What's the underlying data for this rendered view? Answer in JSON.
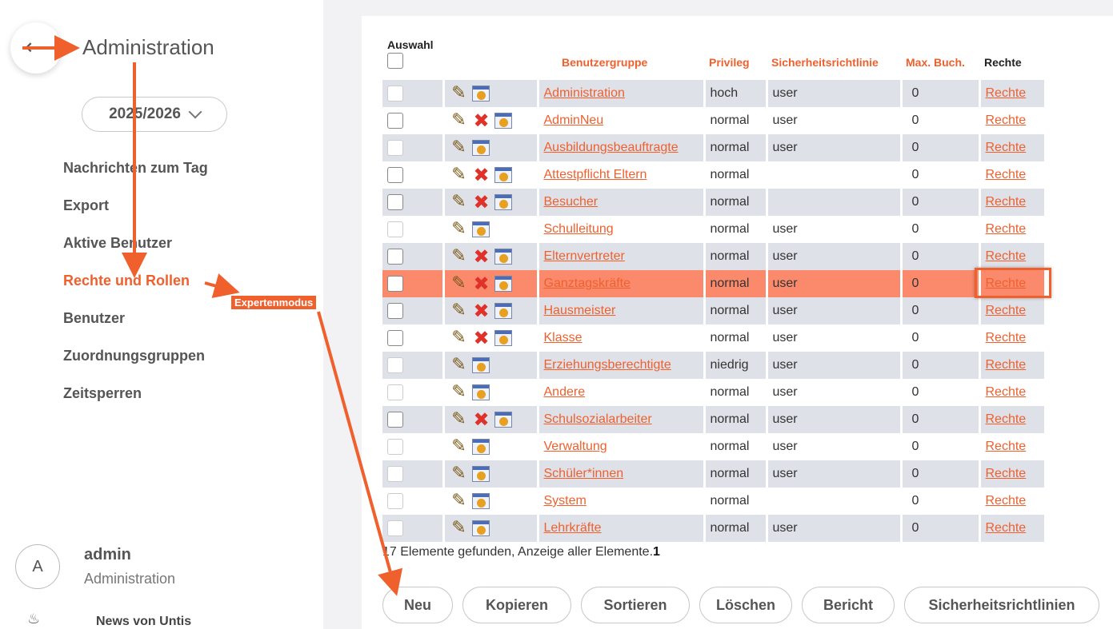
{
  "sidebar": {
    "title": "Administration",
    "year": "2025/2026",
    "nav": [
      "Nachrichten zum Tag",
      "Export",
      "Aktive Benutzer",
      "Rechte und Rollen",
      "Benutzer",
      "Zuordnungsgruppen",
      "Zeitsperren"
    ],
    "active_index": 3,
    "user": {
      "initial": "A",
      "name": "admin",
      "role": "Administration"
    },
    "news": "News von Untis"
  },
  "table": {
    "headers": {
      "select": "Auswahl",
      "group": "Benutzergruppe",
      "privilege": "Privileg",
      "policy": "Sicherheitsrichtlinie",
      "max": "Max. Buch.",
      "rights": "Rechte"
    },
    "rows": [
      {
        "name": "Administration",
        "privilege": "hoch",
        "policy": "user",
        "max": "0",
        "rights": "Rechte",
        "delete": false
      },
      {
        "name": "AdminNeu",
        "privilege": "normal",
        "policy": "user",
        "max": "0",
        "rights": "Rechte",
        "delete": true
      },
      {
        "name": "Ausbildungsbeauftragte",
        "privilege": "normal",
        "policy": "user",
        "max": "0",
        "rights": "Rechte",
        "delete": false
      },
      {
        "name": "Attestpflicht Eltern",
        "privilege": "normal",
        "policy": "",
        "max": "0",
        "rights": "Rechte",
        "delete": true
      },
      {
        "name": "Besucher",
        "privilege": "normal",
        "policy": "",
        "max": "0",
        "rights": "Rechte",
        "delete": true
      },
      {
        "name": "Schulleitung",
        "privilege": "normal",
        "policy": "user",
        "max": "0",
        "rights": "Rechte",
        "delete": false
      },
      {
        "name": "Elternvertreter",
        "privilege": "normal",
        "policy": "user",
        "max": "0",
        "rights": "Rechte",
        "delete": true
      },
      {
        "name": "Ganztagskräfte",
        "privilege": "normal",
        "policy": "user",
        "max": "0",
        "rights": "Rechte",
        "delete": true
      },
      {
        "name": "Hausmeister",
        "privilege": "normal",
        "policy": "user",
        "max": "0",
        "rights": "Rechte",
        "delete": true
      },
      {
        "name": "Klasse",
        "privilege": "normal",
        "policy": "user",
        "max": "0",
        "rights": "Rechte",
        "delete": true
      },
      {
        "name": "Erziehungsberechtigte",
        "privilege": "niedrig",
        "policy": "user",
        "max": "0",
        "rights": "Rechte",
        "delete": false
      },
      {
        "name": "Andere",
        "privilege": "normal",
        "policy": "user",
        "max": "0",
        "rights": "Rechte",
        "delete": false
      },
      {
        "name": "Schulsozialarbeiter",
        "privilege": "normal",
        "policy": "user",
        "max": "0",
        "rights": "Rechte",
        "delete": true
      },
      {
        "name": "Verwaltung",
        "privilege": "normal",
        "policy": "user",
        "max": "0",
        "rights": "Rechte",
        "delete": false
      },
      {
        "name": "Schüler*innen",
        "privilege": "normal",
        "policy": "user",
        "max": "0",
        "rights": "Rechte",
        "delete": false
      },
      {
        "name": "System",
        "privilege": "normal",
        "policy": "",
        "max": "0",
        "rights": "Rechte",
        "delete": false
      },
      {
        "name": "Lehrkräfte",
        "privilege": "normal",
        "policy": "user",
        "max": "0",
        "rights": "Rechte",
        "delete": false
      }
    ],
    "highlight_index": 7,
    "found_text": "17 Elemente gefunden, Anzeige aller Elemente.",
    "page": "1"
  },
  "buttons": [
    "Neu",
    "Kopieren",
    "Sortieren",
    "Löschen",
    "Bericht",
    "Sicherheitsrichtlinien"
  ],
  "annotation": {
    "label": "Expertenmodus"
  },
  "colors": {
    "accent": "#f0602d",
    "row_shade": "#dfe1e8",
    "highlight": "#fb8a6c"
  }
}
